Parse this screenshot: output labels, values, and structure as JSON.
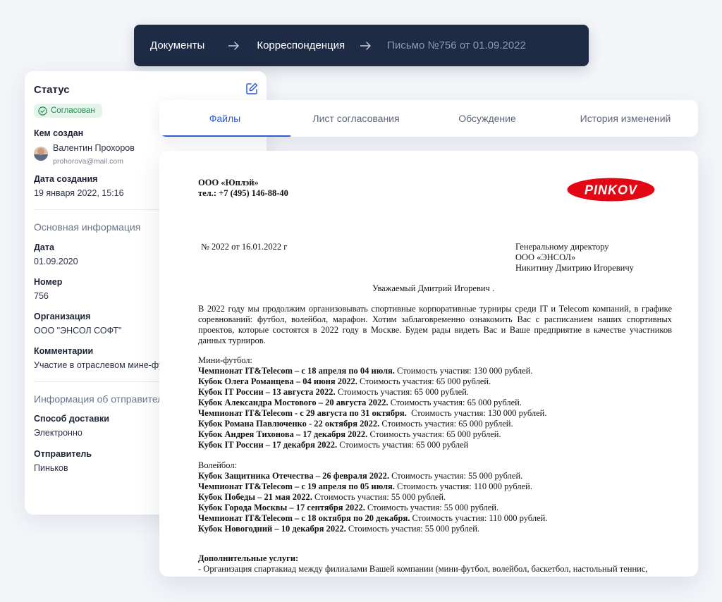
{
  "breadcrumb": [
    "Документы",
    "Корреспонденция",
    "Письмо №756 от 01.09.2022"
  ],
  "status_card": {
    "title": "Статус",
    "badge": "Согласован",
    "created_by_label": "Кем создан",
    "user_name": "Валентин Прохоров",
    "user_email": "prohorova@mail.com",
    "created_date_label": "Дата создания",
    "created_date": "19 января 2022, 15:16",
    "main_info_title": "Основная информация",
    "date_label": "Дата",
    "date_value": "01.09.2020",
    "number_label": "Номер",
    "number_value": "756",
    "org_label": "Организация",
    "org_value": "ООО \"ЭНСОЛ СОФТ\"",
    "comments_label": "Комментарии",
    "comments_value": "Участие в отраслевом мине-футболе",
    "sender_info_title": "Информация об отправителе",
    "delivery_label": "Способ доставки",
    "delivery_value": "Электронно",
    "sender_label": "Отправитель",
    "sender_value": "Пиньков"
  },
  "tabs": [
    "Файлы",
    "Лист согласования",
    "Обсуждение",
    "История изменений"
  ],
  "document": {
    "company": "ООО «Юплэй»",
    "phone": "тел.: +7 (495) 146-88-40",
    "logo_text": "PINKOV",
    "ref": "№ 2022 от 16.01.2022 г",
    "addressee": [
      "Генеральному директору",
      "ООО «ЭНСОЛ»",
      "Никитину Дмитрию Игоревичу"
    ],
    "greeting": "Уважаемый Дмитрий Игоревич .",
    "paragraph": "В 2022 году мы продолжим организовывать спортивные корпоративные турниры среди IT и Telecom компаний, в графике соревнований: футбол, волейбол, марафон. Хотим заблаговременно ознакомить Вас с расписанием наших спортивных проектов, которые состоятся в 2022 году в Москве. Будем рады видеть Вас и Ваше предприятие в качестве участников данных турниров.",
    "mini_football_title": "Мини-футбол:",
    "mini_football": [
      {
        "bold": "Чемпионат IT&Telecom – с 18 апреля по 04 июля.",
        "rest": " Стоимость участия: 130 000 рублей."
      },
      {
        "bold": "Кубок Олега Романцева – 04 июня 2022.",
        "rest": " Стоимость участия: 65 000 рублей."
      },
      {
        "bold": "Кубок IT России – 13 августа 2022.",
        "rest": " Стоимость участия: 65 000 рублей."
      },
      {
        "bold": "Кубок Александра Мостового – 20 августа 2022.",
        "rest": " Стоимость участия: 65 000 рублей."
      },
      {
        "bold": "Чемпионат IT&Telecom - с 29 августа по 31 октября.",
        "rest": "  Стоимость участия: 130 000 рублей."
      },
      {
        "bold": "Кубок Романа Павлюченко - 22 октября 2022.",
        "rest": " Стоимость участия: 65 000 рублей."
      },
      {
        "bold": "Кубок Андрея Тихонова – 17 декабря 2022.",
        "rest": " Стоимость участия: 65 000 рублей."
      },
      {
        "bold": "Кубок IT России – 17 декабря 2022.",
        "rest": " Стоимость участия: 65 000 рублей"
      }
    ],
    "volleyball_title": "Волейбол:",
    "volleyball": [
      {
        "bold": "Кубок Защитника Отечества – 26 февраля 2022.",
        "rest": " Стоимость участия: 55 000 рублей."
      },
      {
        "bold": "Чемпионат IT&Telecom – с 19 апреля по 05 июля.",
        "rest": " Стоимость участия: 110 000 рублей."
      },
      {
        "bold": "Кубок Победы – 21 мая 2022.",
        "rest": " Стоимость участия: 55 000 рублей."
      },
      {
        "bold": "Кубок Города Москвы – 17 сентября 2022.",
        "rest": " Стоимость участия: 55 000 рублей."
      },
      {
        "bold": "Чемпионат IT&Telecom – с 18 октября по 20 декабря.",
        "rest": " Стоимость участия: 110 000 рублей."
      },
      {
        "bold": "Кубок Новогодний – 10 декабря 2022.",
        "rest": " Стоимость участия: 55 000 рублей."
      }
    ],
    "extra_title": "Дополнительные услуги:",
    "extra_line": "- Организация спартакиад между филиалами Вашей компании (мини-футбол, волейбол, баскетбол, настольный теннис,"
  },
  "colors": {
    "accent": "#2f5bd8",
    "nav_bg": "#1e2b45",
    "badge_bg": "#e3f5ea",
    "badge_text": "#1f8a4c",
    "logo_red": "#e30613"
  }
}
